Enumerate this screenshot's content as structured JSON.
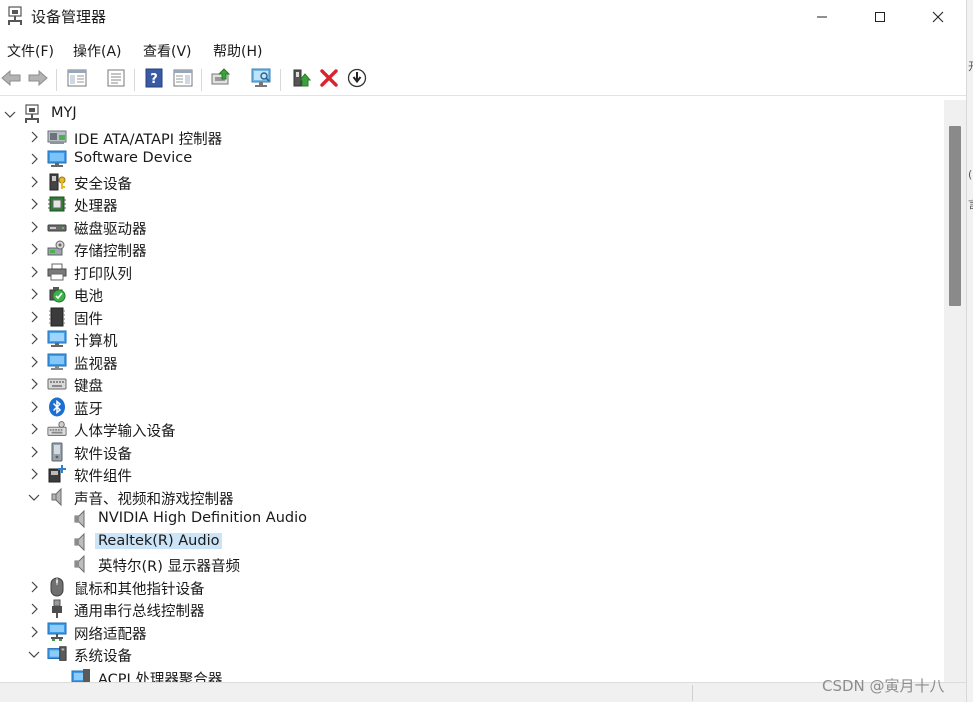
{
  "window": {
    "title": "设备管理器"
  },
  "menubar": {
    "items": [
      "文件(F)",
      "操作(A)",
      "查看(V)",
      "帮助(H)"
    ]
  },
  "toolbar": {
    "buttons": [
      "back-icon",
      "forward-icon",
      "show-hide-console-tree-icon",
      "properties-icon",
      "help-icon",
      "action-pane-icon",
      "update-driver-icon",
      "scan-hardware-changes-icon",
      "enable-device-icon",
      "uninstall-device-icon",
      "disable-device-icon"
    ]
  },
  "tree": {
    "root": "MYJ",
    "categories": [
      {
        "label": "IDE ATA/ATAPI 控制器",
        "icon": "ide-controller-icon"
      },
      {
        "label": "Software Device",
        "icon": "software-device-icon"
      },
      {
        "label": "安全设备",
        "icon": "security-device-icon"
      },
      {
        "label": "处理器",
        "icon": "processor-icon"
      },
      {
        "label": "磁盘驱动器",
        "icon": "disk-drive-icon"
      },
      {
        "label": "存储控制器",
        "icon": "storage-controller-icon"
      },
      {
        "label": "打印队列",
        "icon": "print-queue-icon"
      },
      {
        "label": "电池",
        "icon": "battery-icon"
      },
      {
        "label": "固件",
        "icon": "firmware-icon"
      },
      {
        "label": "计算机",
        "icon": "computer-icon"
      },
      {
        "label": "监视器",
        "icon": "monitor-icon"
      },
      {
        "label": "键盘",
        "icon": "keyboard-icon"
      },
      {
        "label": "蓝牙",
        "icon": "bluetooth-icon"
      },
      {
        "label": "人体学输入设备",
        "icon": "hid-icon"
      },
      {
        "label": "软件设备",
        "icon": "software-devices-icon"
      },
      {
        "label": "软件组件",
        "icon": "software-component-icon"
      }
    ],
    "audio": {
      "label": "声音、视频和游戏控制器",
      "children": [
        "NVIDIA High Definition Audio",
        "Realtek(R) Audio",
        "英特尔(R) 显示器音频"
      ],
      "selected": "Realtek(R) Audio"
    },
    "after": [
      {
        "label": "鼠标和其他指针设备",
        "icon": "mouse-icon"
      },
      {
        "label": "通用串行总线控制器",
        "icon": "usb-controller-icon"
      },
      {
        "label": "网络适配器",
        "icon": "network-adapter-icon"
      }
    ],
    "system": {
      "label": "系统设备",
      "children": [
        "ACPI 处理器聚合器"
      ]
    }
  },
  "watermark": "CSDN @寅月十八",
  "right_edge_text": [
    "开",
    "(",
    "言"
  ]
}
